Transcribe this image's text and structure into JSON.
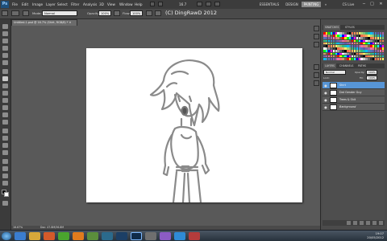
{
  "menubar": {
    "logo": "Ps",
    "items": [
      "File",
      "Edit",
      "Image",
      "Layer",
      "Select",
      "Filter",
      "Analysis",
      "3D",
      "View",
      "Window",
      "Help"
    ],
    "zoom_readout": "16.7",
    "workspaces": [
      "ESSENTIALS",
      "DESIGN",
      "PAINTING"
    ],
    "cslive": "CS Live",
    "window_controls": [
      "−",
      "□",
      "✕"
    ]
  },
  "options": {
    "mode_label": "Mode:",
    "mode_value": "Normal",
    "opacity_label": "Opacity:",
    "opacity_value": "100%",
    "flow_label": "Flow:",
    "flow_value": "100%",
    "watermark": "(C) DingRawD 2012"
  },
  "document": {
    "tab_title": "Untitled-1.psd @ 16.7% (Shirt, RGB/8) * ✕"
  },
  "panels": {
    "color_tabs": [
      "SWATCHES",
      "STYLES"
    ],
    "swatch_colors": [
      "#ff0000",
      "#ffff00",
      "#00ff00",
      "#00ffff",
      "#0000ff",
      "#ff00ff",
      "#ffffff",
      "#cccccc",
      "#999999",
      "#666666",
      "#333333",
      "#000000",
      "#f26c4f",
      "#f68e55",
      "#fbaf5c",
      "#fff467",
      "#acd372",
      "#7cc576",
      "#3bb878",
      "#1abbb4",
      "#00bff3",
      "#438cca",
      "#5574b9",
      "#605ca8",
      "#855fa8",
      "#a763a8",
      "#f06ea9",
      "#f26d7d",
      "#c69c6d",
      "#8c6239"
    ],
    "layers_tabs": [
      "LAYERS",
      "CHANNELS",
      "PATHS"
    ],
    "blend_mode": "Normal",
    "opacity_label": "Opacity:",
    "opacity_value": "100%",
    "lock_label": "Lock:",
    "fill_label": "Fill:",
    "fill_value": "100%",
    "layers": [
      {
        "name": "Shirt",
        "selected": true
      },
      {
        "name": "Dat Gender Guy",
        "selected": false
      },
      {
        "name": "Trees & Shit",
        "selected": false
      },
      {
        "name": "Background",
        "selected": false
      }
    ]
  },
  "status": {
    "zoom": "16.67%",
    "doc_info": "Doc: 47.8M/36.8M"
  },
  "taskbar": {
    "time": "19:07",
    "date": "20/05/2012"
  }
}
